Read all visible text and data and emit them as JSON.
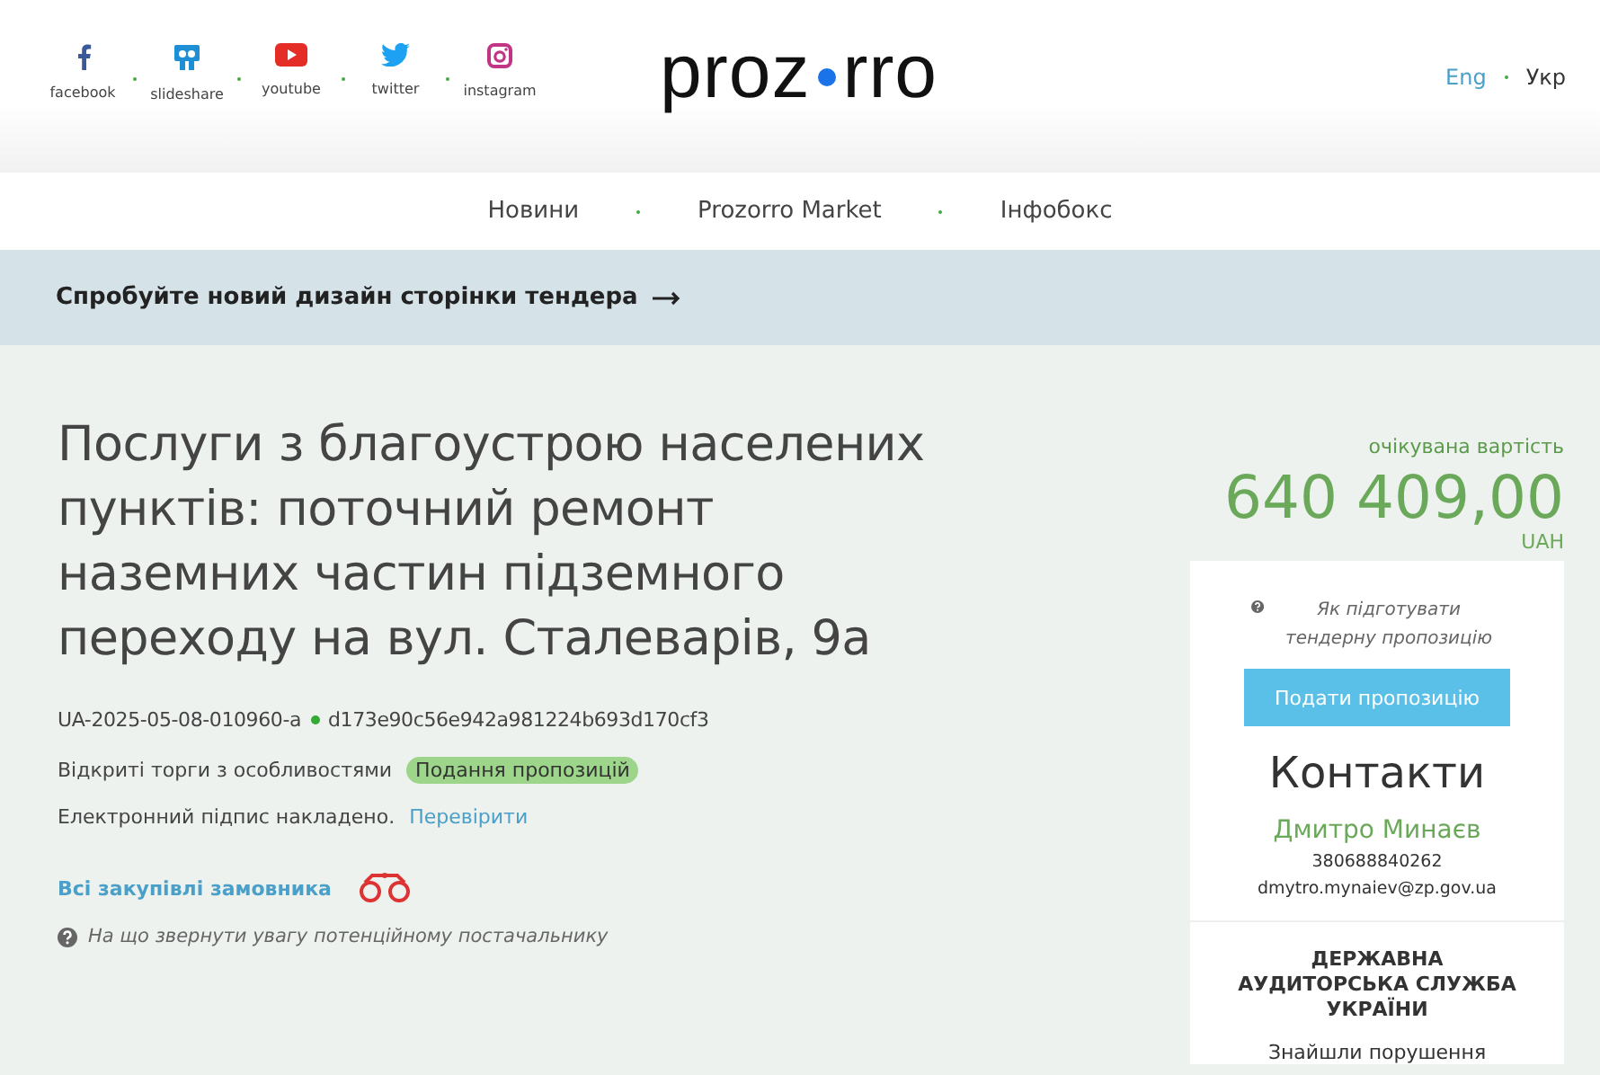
{
  "social_links": [
    {
      "kind": "facebook",
      "label": "facebook"
    },
    {
      "kind": "slideshare",
      "label": "slideshare"
    },
    {
      "kind": "youtube",
      "label": "youtube"
    },
    {
      "kind": "twitter",
      "label": "twitter"
    },
    {
      "kind": "instagram",
      "label": "instagram"
    }
  ],
  "logo": {
    "left": "proz",
    "right": "rro"
  },
  "languages": [
    {
      "label": "Eng",
      "selected": false
    },
    {
      "label": "Укр",
      "selected": true
    }
  ],
  "nav": [
    "Новини",
    "Prozorro Market",
    "Інфобокс"
  ],
  "banner": {
    "text": "Спробуйте новий дизайн сторінки тендера"
  },
  "tender": {
    "title": "Послуги з благоустрою населених пунктів: поточний ремонт наземних частин підземного переходу на вул. Сталеварів, 9а",
    "id": "UA-2025-05-08-010960-a",
    "hash": "d173e90c56e942a981224b693d170cf3",
    "procedure": "Відкриті торги з особливостями",
    "status": "Подання пропозицій",
    "signature": "Електронний підпис накладено.",
    "signature_link": "Перевірити",
    "buyer_link": "Всі закупівлі замовника",
    "hint": "На що звернути увагу потенційному постачальнику"
  },
  "price": {
    "label": "очікувана вартість",
    "amount": "640 409,00",
    "currency": "UAH"
  },
  "sidebar": {
    "hint": "Як підготувати тендерну пропозицію",
    "button": "Подати пропозицію",
    "contacts_title": "Контакти",
    "name": "Дмитро Минаєв",
    "phone": "380688840262",
    "email": "dmytro.mynaiev@zp.gov.ua",
    "audit_title": "ДЕРЖАВНА АУДИТОРСЬКА СЛУЖБА УКРАЇНИ",
    "audit_text": "Знайшли порушення"
  }
}
